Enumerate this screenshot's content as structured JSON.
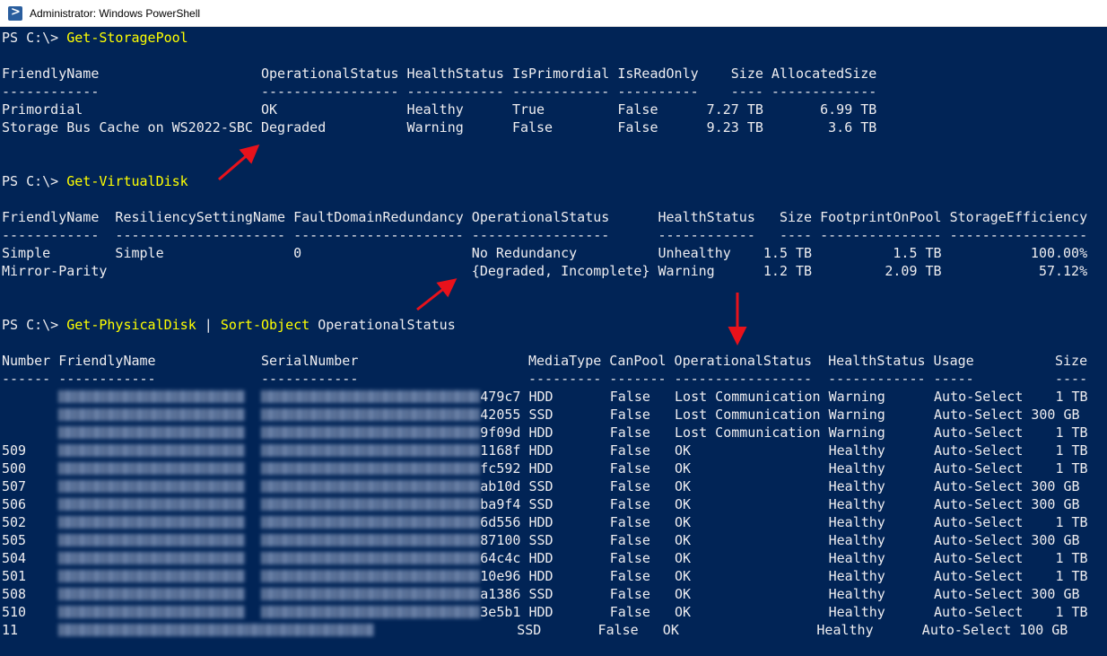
{
  "window": {
    "title": "Administrator: Windows PowerShell"
  },
  "console": {
    "prompt": "PS C:\\> ",
    "commands": {
      "storage_pool": "Get-StoragePool",
      "virtual_disk": "Get-VirtualDisk",
      "physical_disk_1": "Get-PhysicalDisk",
      "pipe": " | ",
      "physical_disk_2": "Sort-Object",
      "physical_disk_arg": " OperationalStatus"
    },
    "pool_header": "FriendlyName                    OperationalStatus HealthStatus IsPrimordial IsReadOnly    Size AllocatedSize",
    "pool_sep": "------------                    ----------------- ------------ ------------ ----------    ---- -------------",
    "pool_rows": [
      "Primordial                      OK                Healthy      True         False      7.27 TB       6.99 TB",
      "Storage Bus Cache on WS2022-SBC Degraded          Warning      False        False      9.23 TB        3.6 TB"
    ],
    "vdisk_header": "FriendlyName  ResiliencySettingName FaultDomainRedundancy OperationalStatus      HealthStatus   Size FootprintOnPool StorageEfficiency",
    "vdisk_sep": "------------  --------------------- --------------------- -----------------      ------------   ---- --------------- -----------------",
    "vdisk_rows": [
      "Simple        Simple                0                     No Redundancy          Unhealthy    1.5 TB          1.5 TB           100.00%",
      "Mirror-Parity                                             {Degraded, Incomplete} Warning      1.2 TB         2.09 TB            57.12%"
    ],
    "pdisk_header": "Number FriendlyName             SerialNumber                     MediaType CanPool OperationalStatus  HealthStatus Usage          Size",
    "pdisk_sep": "------ ------------             ------------                     --------- ------- -----------------  ------------ -----          ----",
    "pdisk_rows": [
      {
        "number": "   ",
        "serial_tail": "479c7",
        "rest": " HDD       False   Lost Communication Warning      Auto-Select    1 TB"
      },
      {
        "number": "   ",
        "serial_tail": "42055",
        "rest": " SSD       False   Lost Communication Warning      Auto-Select 300 GB"
      },
      {
        "number": "   ",
        "serial_tail": "9f09d",
        "rest": " HDD       False   Lost Communication Warning      Auto-Select    1 TB"
      },
      {
        "number": "509",
        "serial_tail": "1168f",
        "rest": " HDD       False   OK                 Healthy      Auto-Select    1 TB"
      },
      {
        "number": "500",
        "serial_tail": "fc592",
        "rest": " HDD       False   OK                 Healthy      Auto-Select    1 TB"
      },
      {
        "number": "507",
        "serial_tail": "ab10d",
        "rest": " SSD       False   OK                 Healthy      Auto-Select 300 GB"
      },
      {
        "number": "506",
        "serial_tail": "ba9f4",
        "rest": " SSD       False   OK                 Healthy      Auto-Select 300 GB"
      },
      {
        "number": "502",
        "serial_tail": "6d556",
        "rest": " HDD       False   OK                 Healthy      Auto-Select    1 TB"
      },
      {
        "number": "505",
        "serial_tail": "87100",
        "rest": " SSD       False   OK                 Healthy      Auto-Select 300 GB"
      },
      {
        "number": "504",
        "serial_tail": "64c4c",
        "rest": " HDD       False   OK                 Healthy      Auto-Select    1 TB"
      },
      {
        "number": "501",
        "serial_tail": "10e96",
        "rest": " HDD       False   OK                 Healthy      Auto-Select    1 TB"
      },
      {
        "number": "508",
        "serial_tail": "a1386",
        "rest": " SSD       False   OK                 Healthy      Auto-Select 300 GB"
      },
      {
        "number": "510",
        "serial_tail": "3e5b1",
        "rest": " HDD       False   OK                 Healthy      Auto-Select    1 TB"
      },
      {
        "number": "11 ",
        "serial_tail": "",
        "rest": " SSD       False   OK                 Healthy      Auto-Select 100 GB"
      }
    ]
  },
  "colors": {
    "console_bg": "#012456",
    "console_fg": "#eeedf0",
    "command": "#ffff00",
    "arrow": "#e8121b"
  }
}
